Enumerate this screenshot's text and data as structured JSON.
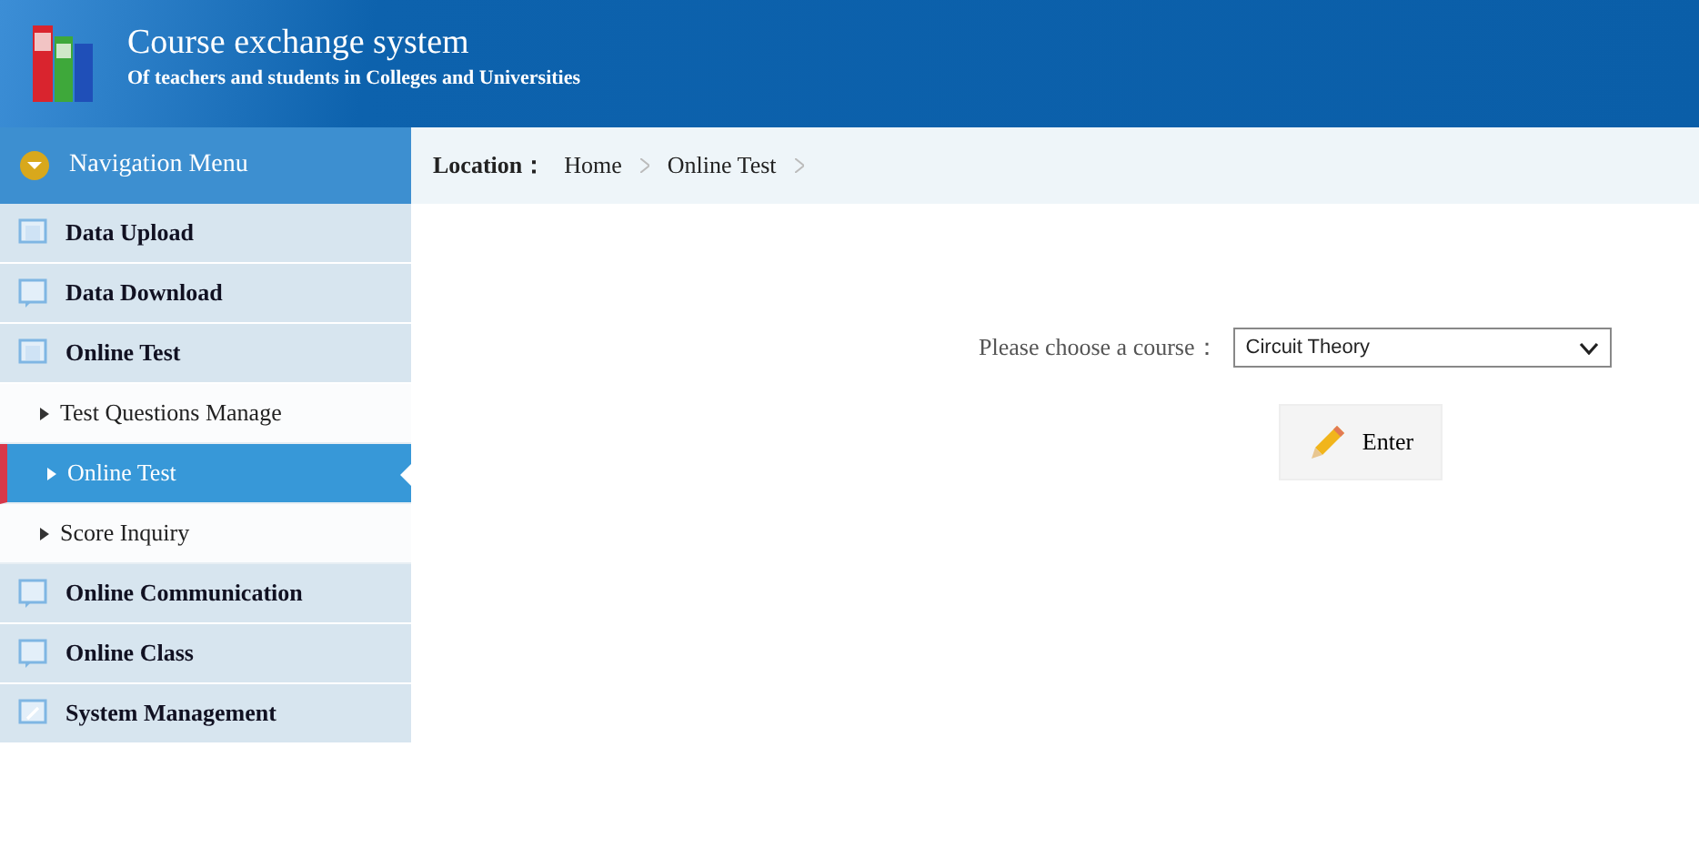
{
  "header": {
    "title": "Course exchange system",
    "subtitle": "Of teachers and students in Colleges and Universities"
  },
  "sidebar": {
    "title": "Navigation Menu",
    "items": [
      {
        "label": "Data Upload"
      },
      {
        "label": "Data Download"
      },
      {
        "label": "Online Test",
        "children": [
          {
            "label": "Test Questions Manage",
            "selected": false
          },
          {
            "label": "Online Test",
            "selected": true
          },
          {
            "label": "Score Inquiry",
            "selected": false
          }
        ]
      },
      {
        "label": "Online Communication"
      },
      {
        "label": "Online Class"
      },
      {
        "label": "System Management"
      }
    ]
  },
  "breadcrumb": {
    "label": "Location：",
    "items": [
      "Home",
      "Online Test"
    ]
  },
  "form": {
    "label": "Please choose a course：",
    "course": "Circuit Theory",
    "button": "Enter"
  }
}
